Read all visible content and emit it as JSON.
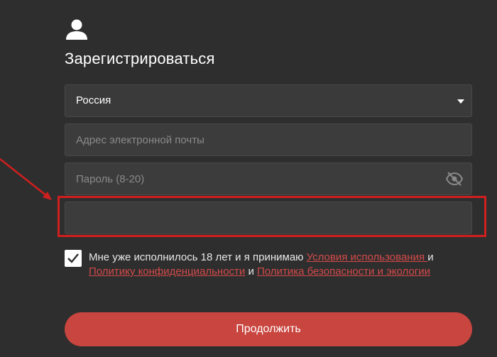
{
  "form": {
    "title": "Зарегистрироваться",
    "country": {
      "value": "Россия"
    },
    "email": {
      "placeholder": "Адрес электронной почты"
    },
    "password": {
      "placeholder": "Пароль (8-20)"
    },
    "captcha": {
      "value": ""
    },
    "agreement": {
      "checked": true,
      "text_before": "Мне уже исполнилось 18 лет и я принимаю ",
      "terms_link": "Условия использования ",
      "and1": "и ",
      "privacy_link": "Политику конфиденциальности",
      "and2": " и ",
      "safety_link": "Политика безопасности и экологии"
    },
    "submit_label": "Продолжить"
  },
  "colors": {
    "background": "#2f2e2e",
    "field": "#3d3c3c",
    "accent": "#c9453f",
    "highlight": "#d01f1f",
    "link": "#d24a4a"
  },
  "icons": [
    "user-icon",
    "eye-slash-icon",
    "chevron-down-icon",
    "checkmark-icon",
    "arrow-annotation"
  ]
}
